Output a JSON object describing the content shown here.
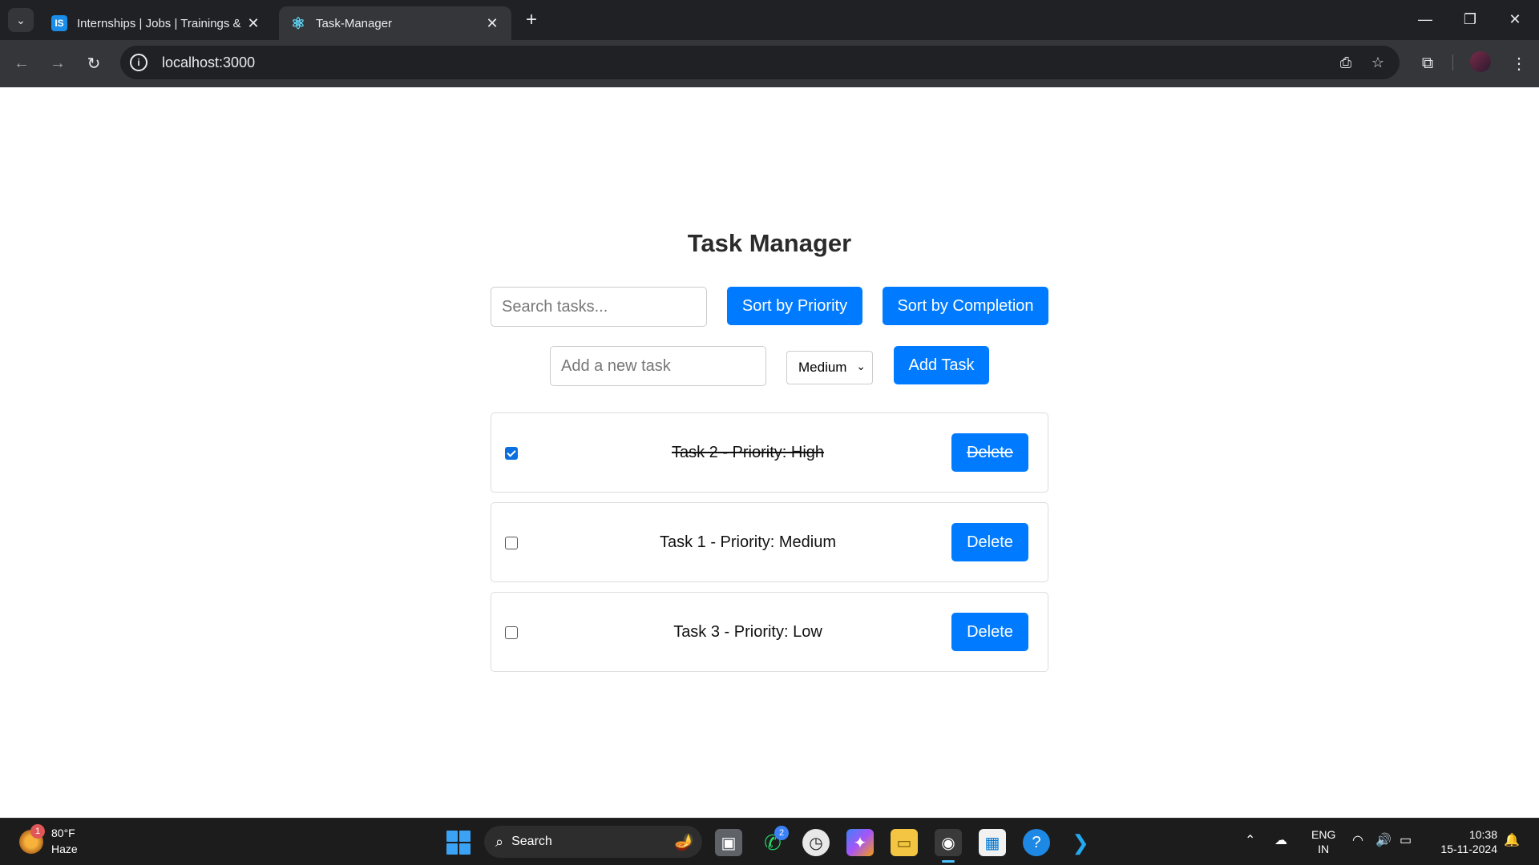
{
  "browser": {
    "tabs": [
      {
        "favicon": "IS",
        "title": "Internships | Jobs | Trainings & I",
        "active": false
      },
      {
        "favicon": "react-icon",
        "title": "Task-Manager",
        "active": true
      }
    ],
    "url": "localhost:3000"
  },
  "app": {
    "title": "Task Manager",
    "search_placeholder": "Search tasks...",
    "sort_priority_label": "Sort by Priority",
    "sort_completion_label": "Sort by Completion",
    "new_task_placeholder": "Add a new task",
    "priority_selected": "Medium",
    "add_task_label": "Add Task",
    "tasks": [
      {
        "label": "Task 2 - Priority: High",
        "completed": true,
        "delete_label": "Delete"
      },
      {
        "label": "Task 1 - Priority: Medium",
        "completed": false,
        "delete_label": "Delete"
      },
      {
        "label": "Task 3 - Priority: Low",
        "completed": false,
        "delete_label": "Delete"
      }
    ]
  },
  "taskbar": {
    "weather_badge": "1",
    "weather_temp": "80°F",
    "weather_condition": "Haze",
    "search_label": "Search",
    "whatsapp_badge": "2",
    "lang_line1": "ENG",
    "lang_line2": "IN",
    "time": "10:38",
    "date": "15-11-2024"
  },
  "colors": {
    "accent": "#007bff",
    "chrome_dark": "#202124",
    "chrome_toolbar": "#35363a"
  }
}
